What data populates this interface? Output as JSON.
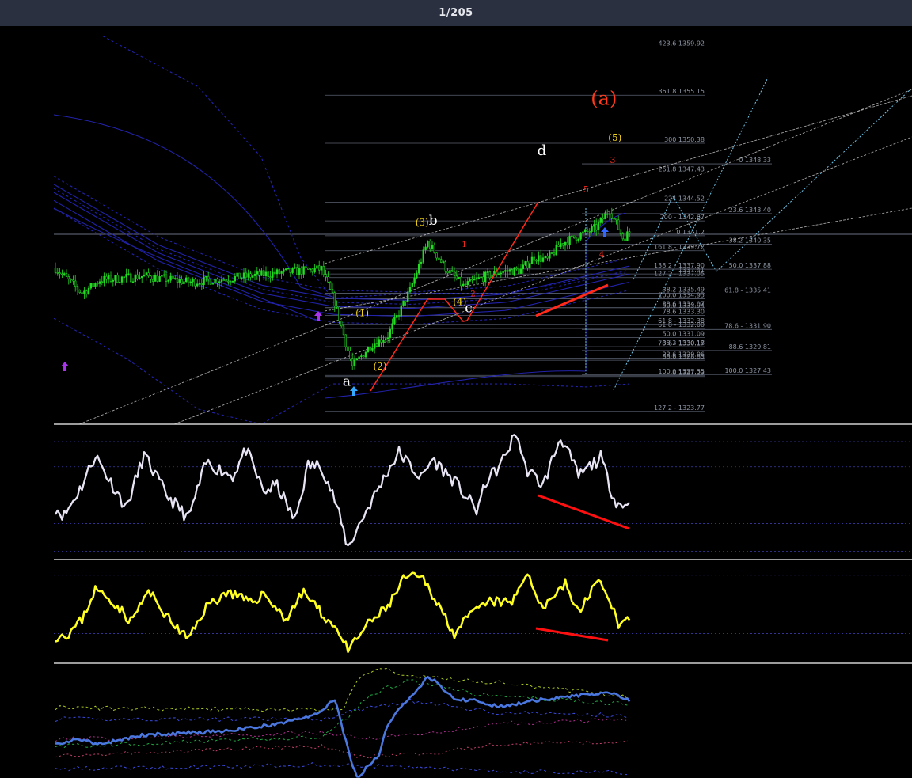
{
  "viewer": {
    "counter": "1/205"
  },
  "colors": {
    "background": "#000000",
    "topbar": "#2b3040",
    "candle": "#22dd22",
    "channel": "#2222aa",
    "fib_line": "#5a6070",
    "dash_white": "#d8d8d8",
    "dash_cyan": "#6fc3e6",
    "wave_red": "#ff2a1a",
    "wave_yellow": "#f2d21c",
    "osc1": "#e8e4f4",
    "osc2": "#ffff22",
    "osc3": "#4a78e0",
    "divergence": "#ff1010"
  },
  "chart_data": [
    {
      "type": "candlestick",
      "title": "",
      "ylim": [
        1322.5,
        1362
      ],
      "grid": false,
      "wave_labels": [
        {
          "text": "a",
          "x": 130,
          "y": 1326.3,
          "color": "#ffffff",
          "size": 17
        },
        {
          "text": "b",
          "x": 169,
          "y": 1342.3,
          "color": "#ffffff",
          "size": 17
        },
        {
          "text": "c",
          "x": 185,
          "y": 1333.6,
          "color": "#ffffff",
          "size": 17
        },
        {
          "text": "d",
          "x": 218,
          "y": 1349.2,
          "color": "#ffffff",
          "size": 18
        },
        {
          "text": "(a)",
          "x": 246,
          "y": 1354.2,
          "color": "#ff3a1a",
          "size": 24
        },
        {
          "text": "(1)",
          "x": 137,
          "y": 1333.2,
          "color": "#f2d21c",
          "size": 12
        },
        {
          "text": "(2)",
          "x": 145,
          "y": 1327.9,
          "color": "#f2d21c",
          "size": 12
        },
        {
          "text": "(3)",
          "x": 164,
          "y": 1342.2,
          "color": "#f2d21c",
          "size": 12
        },
        {
          "text": "(4)",
          "x": 181,
          "y": 1334.3,
          "color": "#f2d21c",
          "size": 12
        },
        {
          "text": "(5)",
          "x": 251,
          "y": 1350.6,
          "color": "#f2d21c",
          "size": 12
        },
        {
          "text": "1",
          "x": 183,
          "y": 1340.1,
          "color": "#ff2a1a",
          "size": 10
        },
        {
          "text": "2",
          "x": 187,
          "y": 1335.2,
          "color": "#ff2a1a",
          "size": 10
        },
        {
          "text": "3",
          "x": 250,
          "y": 1348.4,
          "color": "#ff2a1a",
          "size": 11
        },
        {
          "text": "4",
          "x": 245,
          "y": 1339.1,
          "color": "#ff2a1a",
          "size": 10
        },
        {
          "text": "5",
          "x": 238,
          "y": 1345.5,
          "color": "#ff2a1a",
          "size": 11
        }
      ],
      "fib_levels_left": [
        {
          "label": "423.6 1359.92",
          "value": 1359.92
        },
        {
          "label": "361.8 1355.15",
          "value": 1355.15
        },
        {
          "label": "300 1350.38",
          "value": 1350.38
        },
        {
          "label": "261.8 1347.43",
          "value": 1347.43
        },
        {
          "label": "224 1344.52",
          "value": 1344.52
        },
        {
          "label": "200 - 1342.67",
          "value": 1342.67
        },
        {
          "label": "0 1341.2",
          "value": 1341.2
        },
        {
          "label": "161.8 - 1339.72",
          "value": 1339.72
        },
        {
          "label": "138.2 - 1337.90",
          "value": 1337.9
        },
        {
          "label": "127.2 - 1337.05",
          "value": 1337.05
        },
        {
          "label": "100.0 1334.95",
          "value": 1334.95
        },
        {
          "label": "88.6 1334.07",
          "value": 1334.07
        },
        {
          "label": "78.6 1333.30",
          "value": 1333.3
        },
        {
          "label": "61.8 - 1332.00",
          "value": 1332.0
        },
        {
          "label": "50.0 1331.09",
          "value": 1331.09
        },
        {
          "label": "38.2 1330.18",
          "value": 1330.18
        },
        {
          "label": "23.6 1329.06",
          "value": 1329.06
        },
        {
          "label": "0 1327.23",
          "value": 1327.23
        },
        {
          "label": "1337.41",
          "value": 1337.41
        },
        {
          "label": "38.2 1335.49",
          "value": 1335.49
        },
        {
          "label": "50.0 1333.94",
          "value": 1333.94
        },
        {
          "label": "61.8 - 1332.38",
          "value": 1332.38
        },
        {
          "label": "78.6 - 1330.17",
          "value": 1330.17
        },
        {
          "label": "88.6 1328.85",
          "value": 1328.85
        },
        {
          "label": "100.0 1327.35",
          "value": 1327.35
        },
        {
          "label": "127.2 - 1323.77",
          "value": 1323.77
        }
      ],
      "fib_levels_right": [
        {
          "label": "0 1348.33",
          "value": 1348.33
        },
        {
          "label": "23.6 1343.40",
          "value": 1343.4
        },
        {
          "label": "38.2 1340.35",
          "value": 1340.35
        },
        {
          "label": "50.0 1337.88",
          "value": 1337.88
        },
        {
          "label": "61.8 - 1335.41",
          "value": 1335.41
        },
        {
          "label": "78.6 - 1331.90",
          "value": 1331.9
        },
        {
          "label": "88.6 1329.81",
          "value": 1329.81
        },
        {
          "label": "100.0 1327.43",
          "value": 1327.43
        }
      ]
    },
    {
      "type": "line",
      "name": "",
      "ylim": [
        0,
        100
      ],
      "grid": false
    },
    {
      "type": "line",
      "name": "",
      "ylim": [
        0,
        100
      ],
      "grid": false
    },
    {
      "type": "line",
      "name": "",
      "ylim": [
        0,
        100
      ],
      "grid": false
    }
  ]
}
